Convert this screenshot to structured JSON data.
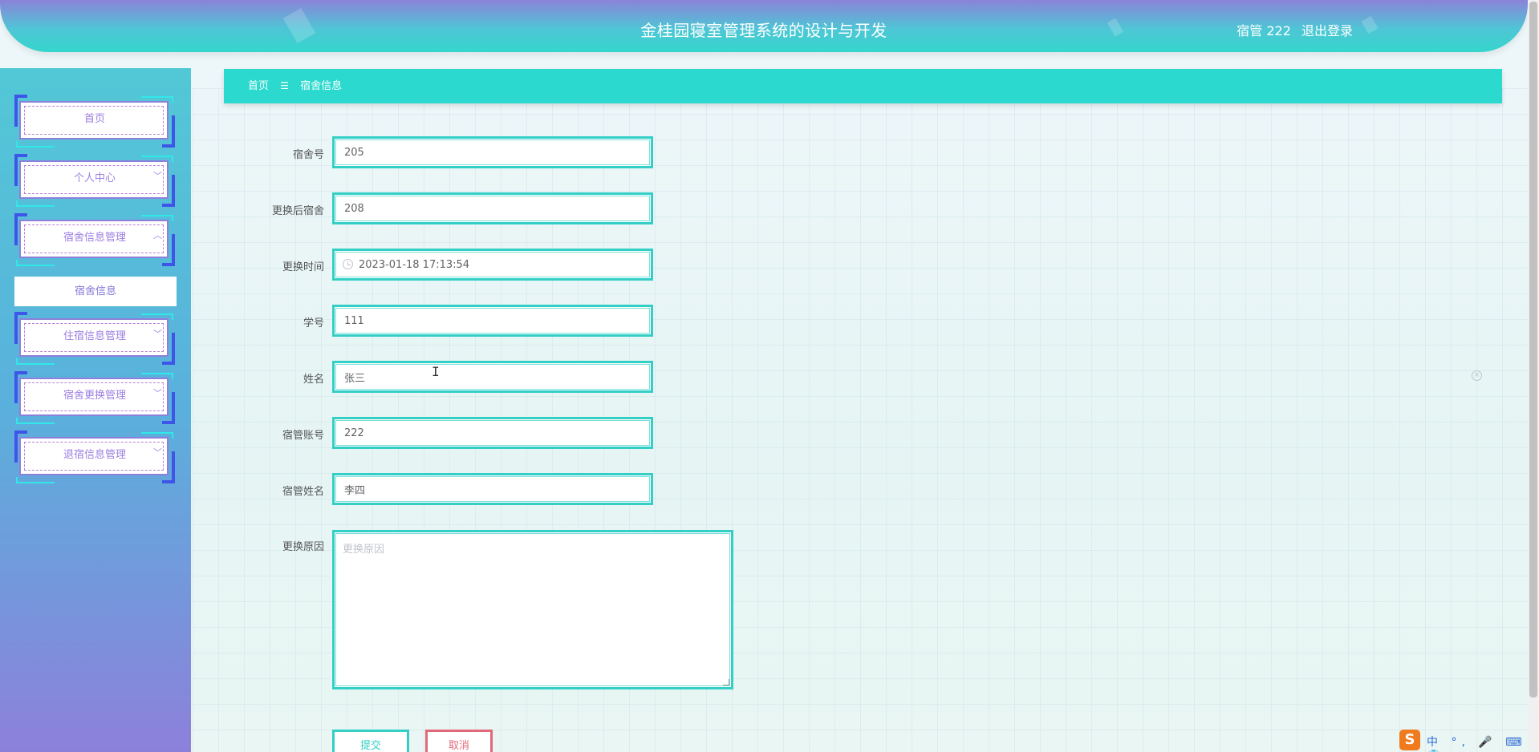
{
  "header": {
    "title": "金桂园寝室管理系统的设计与开发",
    "user_label": "宿管 222",
    "logout_label": "退出登录"
  },
  "sidebar": {
    "items": [
      {
        "label": "首页",
        "chevron": ""
      },
      {
        "label": "个人中心",
        "chevron": "﹀"
      },
      {
        "label": "宿舍信息管理",
        "chevron": "︿"
      },
      {
        "label": "住宿信息管理",
        "chevron": "﹀"
      },
      {
        "label": "宿舍更换管理",
        "chevron": "﹀"
      },
      {
        "label": "退宿信息管理",
        "chevron": "﹀"
      }
    ],
    "sub_item": "宿舍信息"
  },
  "breadcrumb": {
    "home": "首页",
    "sep": "☰",
    "current": "宿舍信息"
  },
  "form": {
    "fields": [
      {
        "label": "宿舍号",
        "value": "205"
      },
      {
        "label": "更换后宿舍",
        "value": "208"
      },
      {
        "label": "更换时间",
        "value": "2023-01-18 17:13:54"
      },
      {
        "label": "学号",
        "value": "111"
      },
      {
        "label": "姓名",
        "value": "张三"
      },
      {
        "label": "宿管账号",
        "value": "222"
      },
      {
        "label": "宿管姓名",
        "value": "李四"
      }
    ],
    "reason_label": "更换原因",
    "reason_placeholder": "更换原因",
    "submit_label": "提交",
    "cancel_label": "取消"
  },
  "ime": {
    "logo": "S",
    "text": "中 °, 🎤 ⌨ 👕 ⊞"
  },
  "colors": {
    "accent": "#2bd9cf",
    "menu_text": "#9c7fe0",
    "cancel": "#e06a7a"
  }
}
